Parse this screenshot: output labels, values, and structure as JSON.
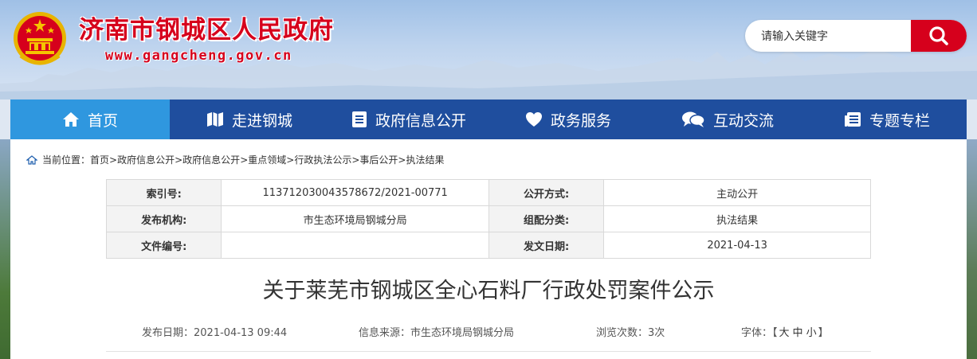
{
  "site": {
    "title": "济南市钢城区人民政府",
    "url": "www.gangcheng.gov.cn"
  },
  "search": {
    "placeholder": "请输入关键字"
  },
  "nav": {
    "items": [
      {
        "label": "首页",
        "icon": "home-icon"
      },
      {
        "label": "走进钢城",
        "icon": "map-icon"
      },
      {
        "label": "政府信息公开",
        "icon": "document-icon"
      },
      {
        "label": "政务服务",
        "icon": "heart-icon"
      },
      {
        "label": "互动交流",
        "icon": "chat-icon"
      },
      {
        "label": "专题专栏",
        "icon": "newspaper-icon"
      }
    ]
  },
  "breadcrumb": {
    "prefix": "当前位置：",
    "items": [
      "首页",
      "政府信息公开",
      "政府信息公开",
      "重点领域",
      "行政执法公示",
      "事后公开",
      "执法结果"
    ],
    "separator": ">"
  },
  "meta": {
    "rows": [
      {
        "l1": "索引号:",
        "v1": "113712030043578672/2021-00771",
        "l2": "公开方式:",
        "v2": "主动公开"
      },
      {
        "l1": "发布机构:",
        "v1": "市生态环境局钢城分局",
        "l2": "组配分类:",
        "v2": "执法结果"
      },
      {
        "l1": "文件编号:",
        "v1": "",
        "l2": "发文日期:",
        "v2": "2021-04-13"
      }
    ]
  },
  "article": {
    "title": "关于莱芜市钢城区全心石料厂行政处罚案件公示",
    "publish_date": "发布日期：2021-04-13 09:44",
    "source": "信息来源：市生态环境局钢城分局",
    "views": "浏览次数：3次",
    "font_label": "字体：",
    "font_open": "【",
    "font_large": "大",
    "font_medium": "中",
    "font_small": "小",
    "font_close": "】"
  },
  "colors": {
    "brand_red": "#d6001c",
    "nav_blue": "#1f4e9e",
    "nav_active": "#2f97df"
  }
}
